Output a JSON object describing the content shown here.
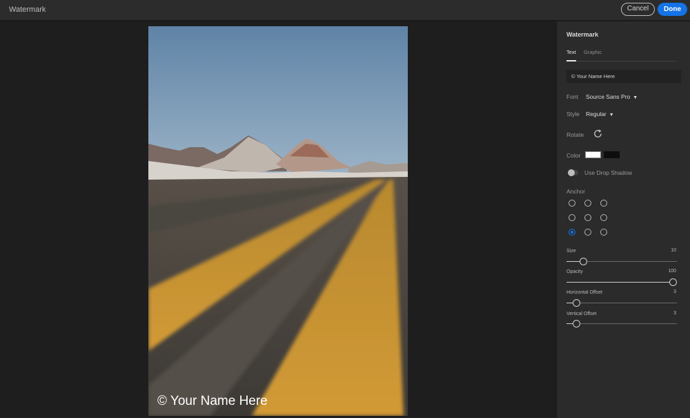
{
  "app": {
    "title": "Watermark"
  },
  "topbar": {
    "cancel_label": "Cancel",
    "done_label": "Done",
    "accent_color": "#1473e6"
  },
  "canvas": {
    "watermark_text": "© Your Name Here"
  },
  "panel": {
    "title": "Watermark",
    "tabs": [
      {
        "label": "Text",
        "active": true
      },
      {
        "label": "Graphic",
        "active": false
      }
    ],
    "text_value": "© Your Name Here",
    "font": {
      "label": "Font",
      "value": "Source Sans Pro"
    },
    "style": {
      "label": "Style",
      "value": "Regular"
    },
    "rotate": {
      "label": "Rotate",
      "icon": "rotate-icon"
    },
    "color": {
      "label": "Color",
      "swatches": [
        "#ffffff",
        "#000000"
      ]
    },
    "drop_shadow": {
      "label": "Use Drop Shadow",
      "enabled": false
    },
    "anchor": {
      "label": "Anchor",
      "selected": "bottom-left"
    },
    "sliders": {
      "size": {
        "label": "Size",
        "value": "10",
        "fraction": 0.125
      },
      "opacity": {
        "label": "Opacity",
        "value": "100",
        "fraction": 1.0
      },
      "horizontal_offset": {
        "label": "Horizontal Offset",
        "value": "3",
        "fraction": 0.06
      },
      "vertical_offset": {
        "label": "Vertical Offset",
        "value": "3",
        "fraction": 0.06
      }
    }
  }
}
